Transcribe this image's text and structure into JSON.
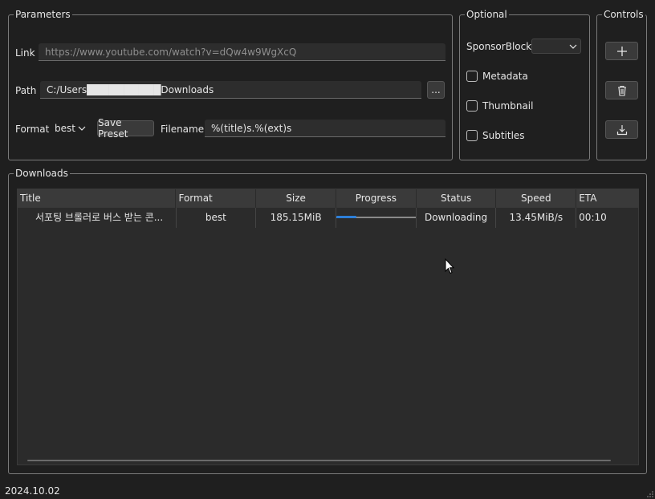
{
  "parameters": {
    "legend": "Parameters",
    "link_label": "Link",
    "link_placeholder": "https://www.youtube.com/watch?v=dQw4w9WgXcQ",
    "path_label": "Path",
    "path_value": "C:/Users██████████Downloads",
    "browse_label": "...",
    "format_label": "Format",
    "format_value": "best",
    "save_preset_label": "Save Preset",
    "filename_label": "Filename",
    "filename_value": "%(title)s.%(ext)s"
  },
  "optional": {
    "legend": "Optional",
    "sponsorblock_label": "SponsorBlock",
    "sponsorblock_value": "",
    "metadata_label": "Metadata",
    "thumbnail_label": "Thumbnail",
    "subtitles_label": "Subtitles"
  },
  "controls": {
    "legend": "Controls",
    "add_icon": "plus-icon",
    "delete_icon": "trash-icon",
    "download_icon": "download-icon"
  },
  "downloads": {
    "legend": "Downloads",
    "columns": [
      "Title",
      "Format",
      "Size",
      "Progress",
      "Status",
      "Speed",
      "ETA"
    ],
    "rows": [
      {
        "title": "서포팅 브롤러로 버스 받는 콘...",
        "format": "best",
        "size": "185.15MiB",
        "progress": 0.25,
        "status": "Downloading",
        "speed": "13.45MiB/s",
        "eta": "00:10"
      }
    ]
  },
  "footer": {
    "version": "2024.10.02"
  },
  "colors": {
    "accent": "#2d7fd8",
    "background": "#1f1f1f",
    "border": "#7a7a7a"
  }
}
